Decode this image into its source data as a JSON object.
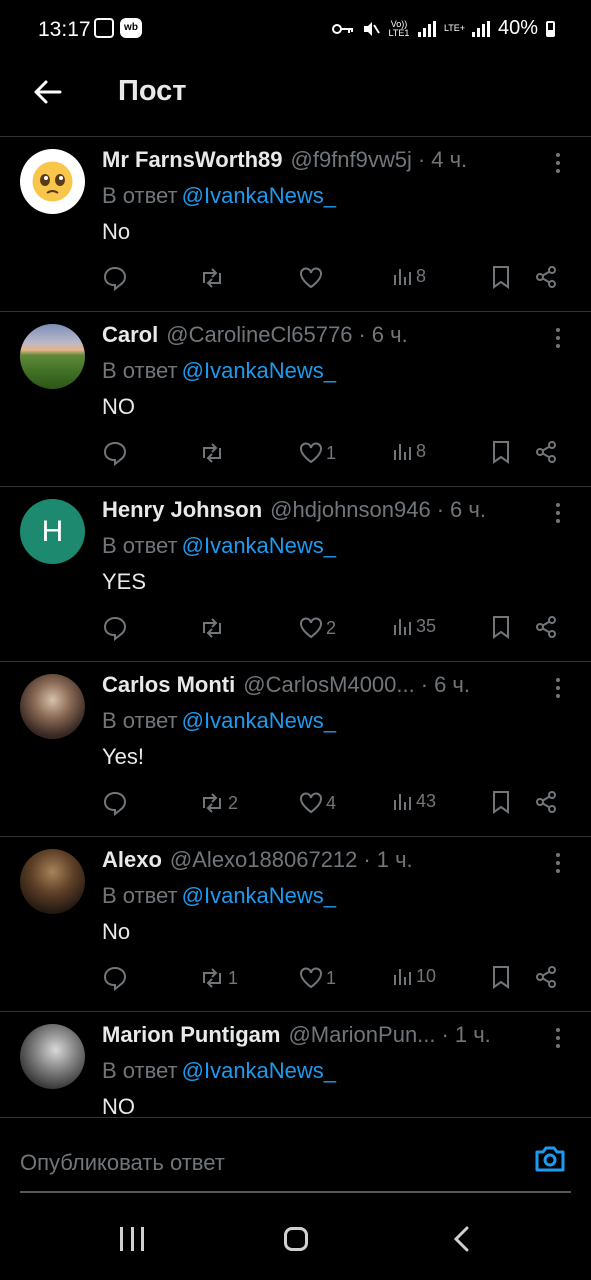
{
  "status_bar": {
    "time": "13:17",
    "battery": "40%",
    "net1": "Vo)) LTE1",
    "net2": "LTE+",
    "app_badge": "wb"
  },
  "header": {
    "title": "Пост"
  },
  "reply_prefix": "В ответ",
  "posts": [
    {
      "name": "Mr FarnsWorth89",
      "handle": "@f9fnf9vw5j",
      "time": "4 ч.",
      "reply_to": "@IvankaNews_",
      "text": "No",
      "reposts": "",
      "likes": "",
      "views": "8",
      "avatar": "pleading-face-emoji"
    },
    {
      "name": "Carol",
      "handle": "@CarolineCl65776",
      "time": "6 ч.",
      "reply_to": "@IvankaNews_",
      "text": "NO",
      "reposts": "",
      "likes": "1",
      "views": "8",
      "avatar": "field-landscape"
    },
    {
      "name": "Henry Johnson",
      "handle": "@hdjohnson946",
      "time": "6 ч.",
      "reply_to": "@IvankaNews_",
      "text": "YES",
      "reposts": "",
      "likes": "2",
      "views": "35",
      "avatar_letter": "H"
    },
    {
      "name": "Carlos Monti",
      "handle": "@CarlosM4000...",
      "time": "6 ч.",
      "reply_to": "@IvankaNews_",
      "text": "Yes!",
      "reposts": "2",
      "likes": "4",
      "views": "43",
      "avatar": "man-photo"
    },
    {
      "name": "Alexo",
      "handle": "@Alexo188067212",
      "time": "1 ч.",
      "reply_to": "@IvankaNews_",
      "text": "No",
      "reposts": "1",
      "likes": "1",
      "views": "10",
      "avatar": "painting"
    },
    {
      "name": "Marion Puntigam",
      "handle": "@MarionPun...",
      "time": "1 ч.",
      "reply_to": "@IvankaNews_",
      "text": "NO",
      "reposts": "",
      "likes": "",
      "views": "",
      "avatar": "woman-photo"
    }
  ],
  "compose": {
    "placeholder": "Опубликовать ответ"
  },
  "colors": {
    "accent": "#1d9bf0",
    "muted": "#71767b",
    "divider": "#2f3336"
  }
}
